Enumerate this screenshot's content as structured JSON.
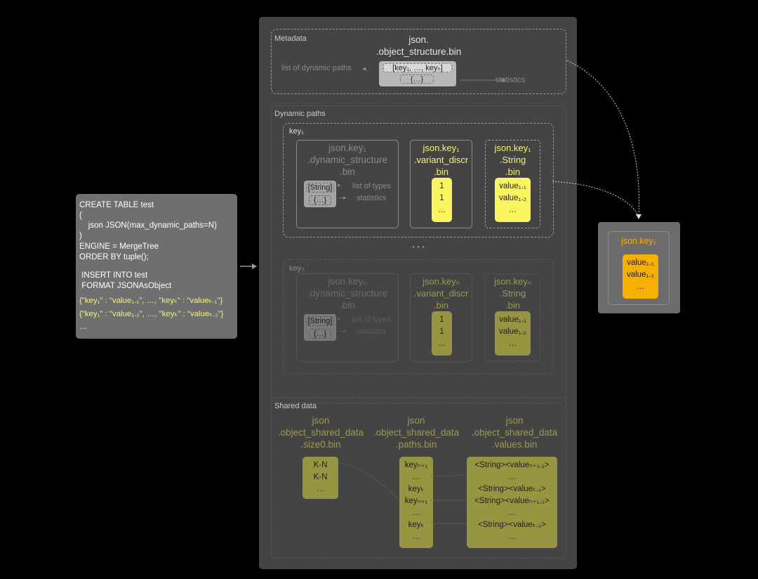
{
  "sql": {
    "lines": [
      "CREATE TABLE test",
      "(",
      "    json JSON(max_dynamic_paths=N)",
      ")",
      "ENGINE = MergeTree",
      "ORDER BY tuple();",
      "",
      " INSERT INTO test",
      " FORMAT JSONAsObject"
    ],
    "rows": [
      "{\"key₁\" : \"value₁.₁\", …, \"keyₖ\" : \"valueₖ.₁\"}",
      "{\"key₁\" : \"value₁.₂\", …, \"keyₖ\" : \"valueₖ.₂\"}"
    ],
    "ellipsis": "…"
  },
  "metadata": {
    "label": "Metadata",
    "title1": "json.",
    "title2": ".object_structure.bin",
    "keys": "[key₁, …, keyₙ]",
    "obj": "{…}",
    "list_label": "list of dynamic paths",
    "stats_label": "statistics"
  },
  "dynamic": {
    "label": "Dynamic paths",
    "dots": "• • •",
    "key1": {
      "label": "key₁",
      "struct_title": [
        "json.key₁",
        ".dynamic_structure",
        ".bin"
      ],
      "string_tag": "[String]",
      "obj": "{…}",
      "types_label": "list of types",
      "stats_label": "statistics",
      "discr_title": [
        "json.key₁",
        ".variant_discr",
        ".bin"
      ],
      "discr_values": [
        "1",
        "1",
        "…"
      ],
      "str_title": [
        "json.key₁",
        ".String",
        ".bin"
      ],
      "str_values": [
        "value₁.₁",
        "value₁.₂",
        "…"
      ]
    },
    "keyn": {
      "label": "keyₙ",
      "struct_title": [
        "json.keyₙ",
        ".dynamic_structure",
        ".bin"
      ],
      "string_tag": "[String]",
      "obj": "{…}",
      "types_label": "list of types",
      "stats_label": "statistics",
      "discr_title": [
        "json.keyₙ",
        ".variant_discr",
        ".bin"
      ],
      "discr_values": [
        "1",
        "1",
        "…"
      ],
      "str_title": [
        "json.keyₙ",
        ".String",
        ".bin"
      ],
      "str_values": [
        "value₁.₁",
        "value₁.₂",
        "…"
      ]
    }
  },
  "shared": {
    "label": "Shared data",
    "size_title": [
      "json",
      ".object_shared_data",
      ".size0.bin"
    ],
    "size_values": [
      "K-N",
      "K-N",
      "…"
    ],
    "paths_title": [
      "json",
      ".object_shared_data",
      ".paths.bin"
    ],
    "paths_values": [
      "keyₙ₊₁",
      "…",
      "keyₖ",
      "keyₙ₊₁",
      "…",
      "keyₖ",
      "…"
    ],
    "values_title": [
      "json",
      ".object_shared_data",
      ".values.bin"
    ],
    "values_values": [
      "<String><valueₙ₊₁.₁>",
      "…",
      "<String><valueₖ.₁>",
      "<String><valueₙ₊₁.₂>",
      "…",
      "<String><valueₖ.₂>",
      "…"
    ]
  },
  "result": {
    "title": "json.key₁",
    "values": [
      "value₁.₁",
      "value₁.₂",
      "…"
    ]
  },
  "colors": {
    "panel": "#444444",
    "highlight_yellow": "#fbf55f",
    "dim_olive": "#979541",
    "orange": "#f7b000",
    "title_yellow": "#f8f36e"
  }
}
